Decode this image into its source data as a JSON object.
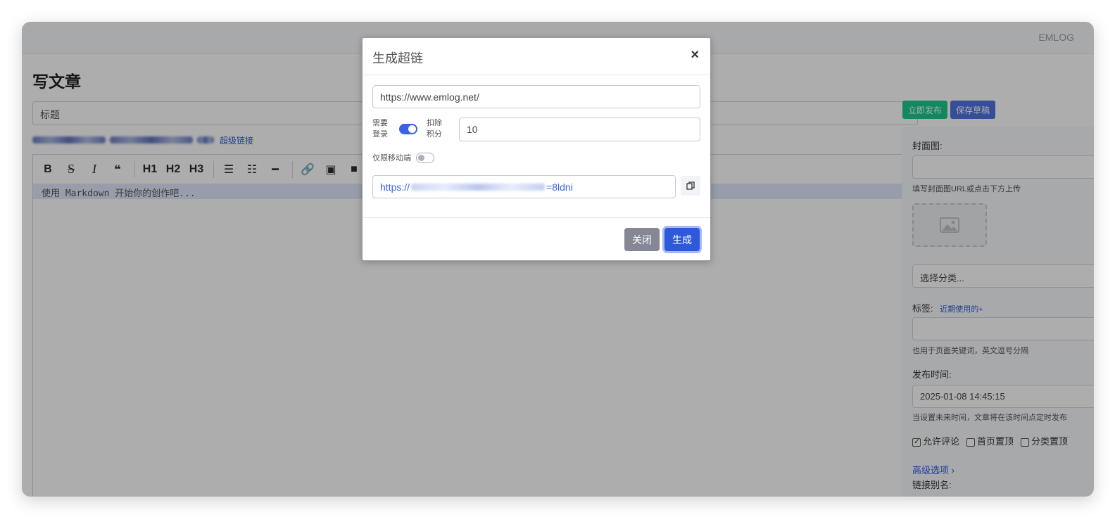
{
  "app": {
    "brand": "EMLOG",
    "page_title": "写文章",
    "title_placeholder": "标题",
    "hyperlink_label": "超级链接",
    "editor_placeholder": "使用 Markdown 开始你的创作吧..."
  },
  "toolbar": {
    "bold": "B",
    "strike": "S",
    "italic": "I",
    "quote": "❝",
    "h1": "H1",
    "h2": "H2",
    "h3": "H3",
    "ul": "☰",
    "ol": "☷",
    "hr": "━",
    "link": "🔗",
    "image": "▣",
    "video": "■"
  },
  "actions": {
    "publish": "立即发布",
    "save_draft": "保存草稿"
  },
  "sidebar": {
    "cover_label": "封面图:",
    "cover_hint": "填写封面图URL或点击下方上传",
    "category_value": "选择分类...",
    "tags_label": "标签:",
    "tags_recent": "近期使用的+",
    "tags_hint": "也用于页面关键词，英文逗号分隔",
    "publish_time_label": "发布时间:",
    "publish_time_value": "2025-01-08 14:45:15",
    "publish_time_hint": "当设置未来时间，文章将在该时间点定时发布",
    "allow_comments": "允许评论",
    "home_top": "首页置顶",
    "category_top": "分类置顶",
    "advanced": "高级选项 ›",
    "slug_label": "链接别名:"
  },
  "modal": {
    "title": "生成超链",
    "close_symbol": "×",
    "url_value": "https://www.emlog.net/",
    "require_login_label": "需要登录",
    "require_login_line1": "需要",
    "require_login_line2": "登录",
    "require_login_on": true,
    "deduct_points_line1": "扣除",
    "deduct_points_line2": "积分",
    "points_value": "10",
    "mobile_only_label": "仅限移动端",
    "mobile_only_on": false,
    "generated_prefix": "https://",
    "generated_suffix": "=8ldni",
    "close_button": "关闭",
    "generate_button": "生成"
  }
}
